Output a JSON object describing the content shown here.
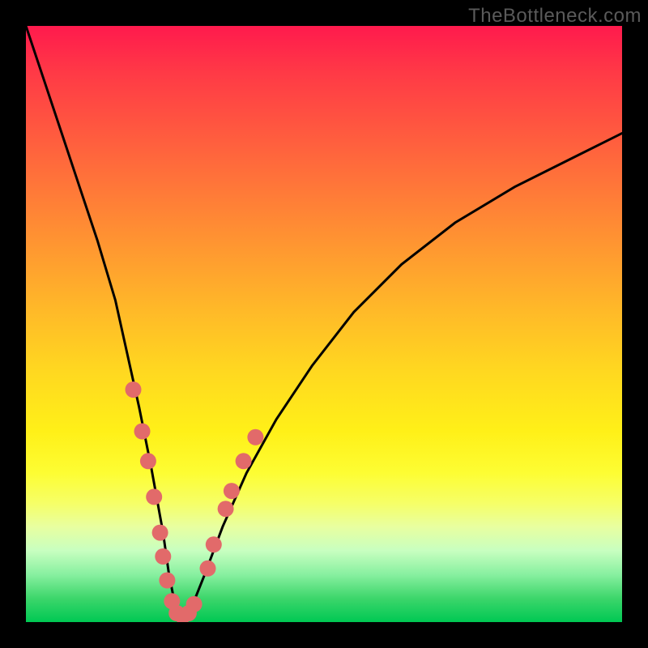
{
  "watermark": "TheBottleneck.com",
  "chart_data": {
    "type": "line",
    "title": "",
    "xlabel": "",
    "ylabel": "",
    "xlim": [
      0,
      100
    ],
    "ylim": [
      0,
      100
    ],
    "series": [
      {
        "name": "bottleneck-curve",
        "x": [
          0,
          3,
          6,
          9,
          12,
          15,
          17,
          19,
          21,
          23,
          24,
          25,
          26,
          27,
          28,
          30,
          33,
          37,
          42,
          48,
          55,
          63,
          72,
          82,
          92,
          100
        ],
        "y": [
          100,
          91,
          82,
          73,
          64,
          54,
          45,
          36,
          26,
          15,
          8,
          3,
          1,
          1,
          3,
          8,
          16,
          25,
          34,
          43,
          52,
          60,
          67,
          73,
          78,
          82
        ]
      }
    ],
    "markers": {
      "name": "sample-points",
      "color": "#e26a6a",
      "radius": 10,
      "points": [
        {
          "x": 18.0,
          "y": 39
        },
        {
          "x": 19.5,
          "y": 32
        },
        {
          "x": 20.5,
          "y": 27
        },
        {
          "x": 21.5,
          "y": 21
        },
        {
          "x": 22.5,
          "y": 15
        },
        {
          "x": 23.0,
          "y": 11
        },
        {
          "x": 23.7,
          "y": 7
        },
        {
          "x": 24.5,
          "y": 3.5
        },
        {
          "x": 25.3,
          "y": 1.5
        },
        {
          "x": 26.3,
          "y": 1.0
        },
        {
          "x": 27.3,
          "y": 1.5
        },
        {
          "x": 28.2,
          "y": 3.0
        },
        {
          "x": 30.5,
          "y": 9
        },
        {
          "x": 31.5,
          "y": 13
        },
        {
          "x": 33.5,
          "y": 19
        },
        {
          "x": 34.5,
          "y": 22
        },
        {
          "x": 36.5,
          "y": 27
        },
        {
          "x": 38.5,
          "y": 31
        }
      ]
    }
  }
}
